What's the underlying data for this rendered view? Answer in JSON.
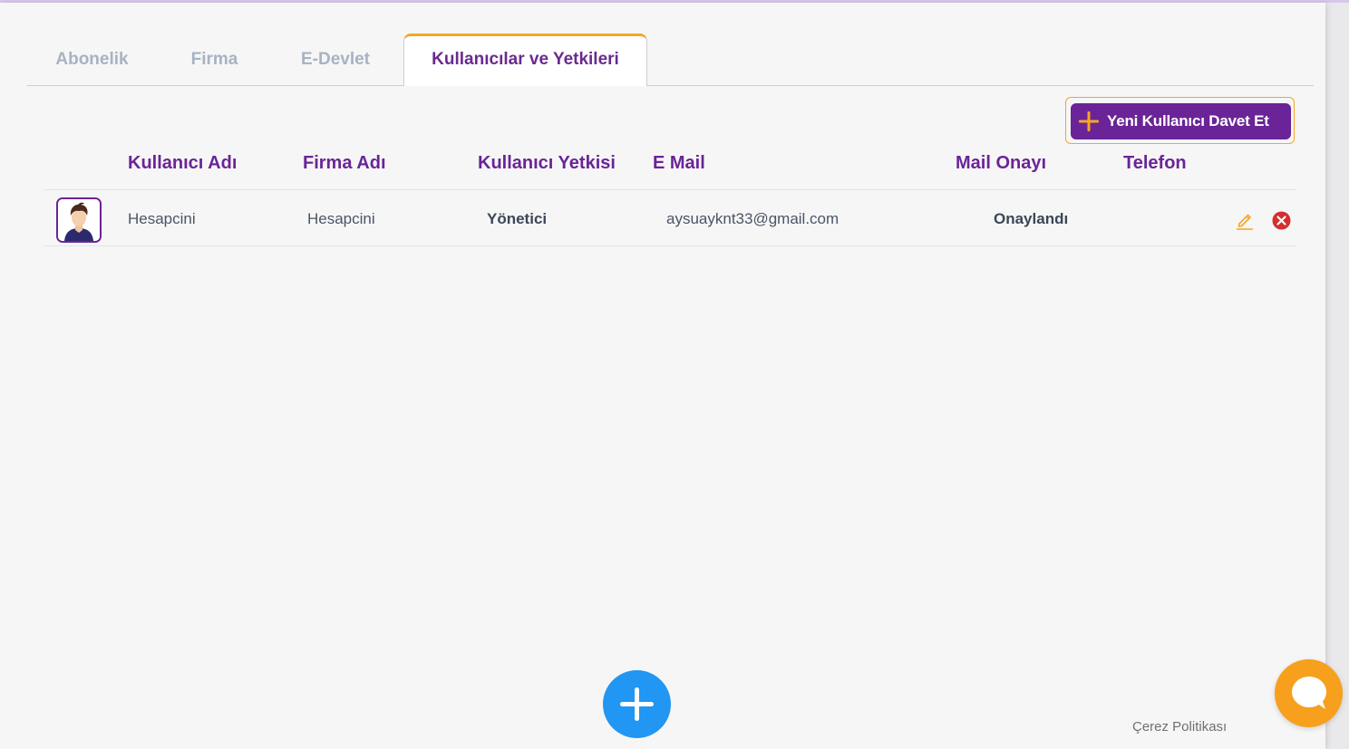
{
  "tabs": [
    {
      "label": "Abonelik",
      "active": false
    },
    {
      "label": "Firma",
      "active": false
    },
    {
      "label": "E-Devlet",
      "active": false
    },
    {
      "label": "Kullanıcılar ve Yetkileri",
      "active": true
    }
  ],
  "toolbar": {
    "invite_label": "Yeni Kullanıcı Davet Et"
  },
  "table": {
    "headers": [
      "Kullanıcı Adı",
      "Firma Adı",
      "Kullanıcı Yetkisi",
      "E Mail",
      "Mail Onayı",
      "Telefon"
    ],
    "rows": [
      {
        "username": "Hesapcini",
        "company": "Hesapcini",
        "role": "Yönetici",
        "email": "aysuayknt33@gmail.com",
        "mail_status": "Onaylandı",
        "phone": ""
      }
    ]
  },
  "footer": {
    "cookie_policy": "Çerez Politikası"
  },
  "icons": {
    "row_edit": "pencil-icon",
    "row_delete": "close-circle-icon",
    "fab": "plus-icon",
    "chat": "chat-bubble-icon",
    "avatar": "user-avatar-icon"
  },
  "colors": {
    "brand_purple": "#6a2497",
    "accent_orange": "#f5a623",
    "fab_blue": "#2196f3",
    "delete_red": "#d32f2f",
    "inactive_tab": "#a7b3c3"
  }
}
